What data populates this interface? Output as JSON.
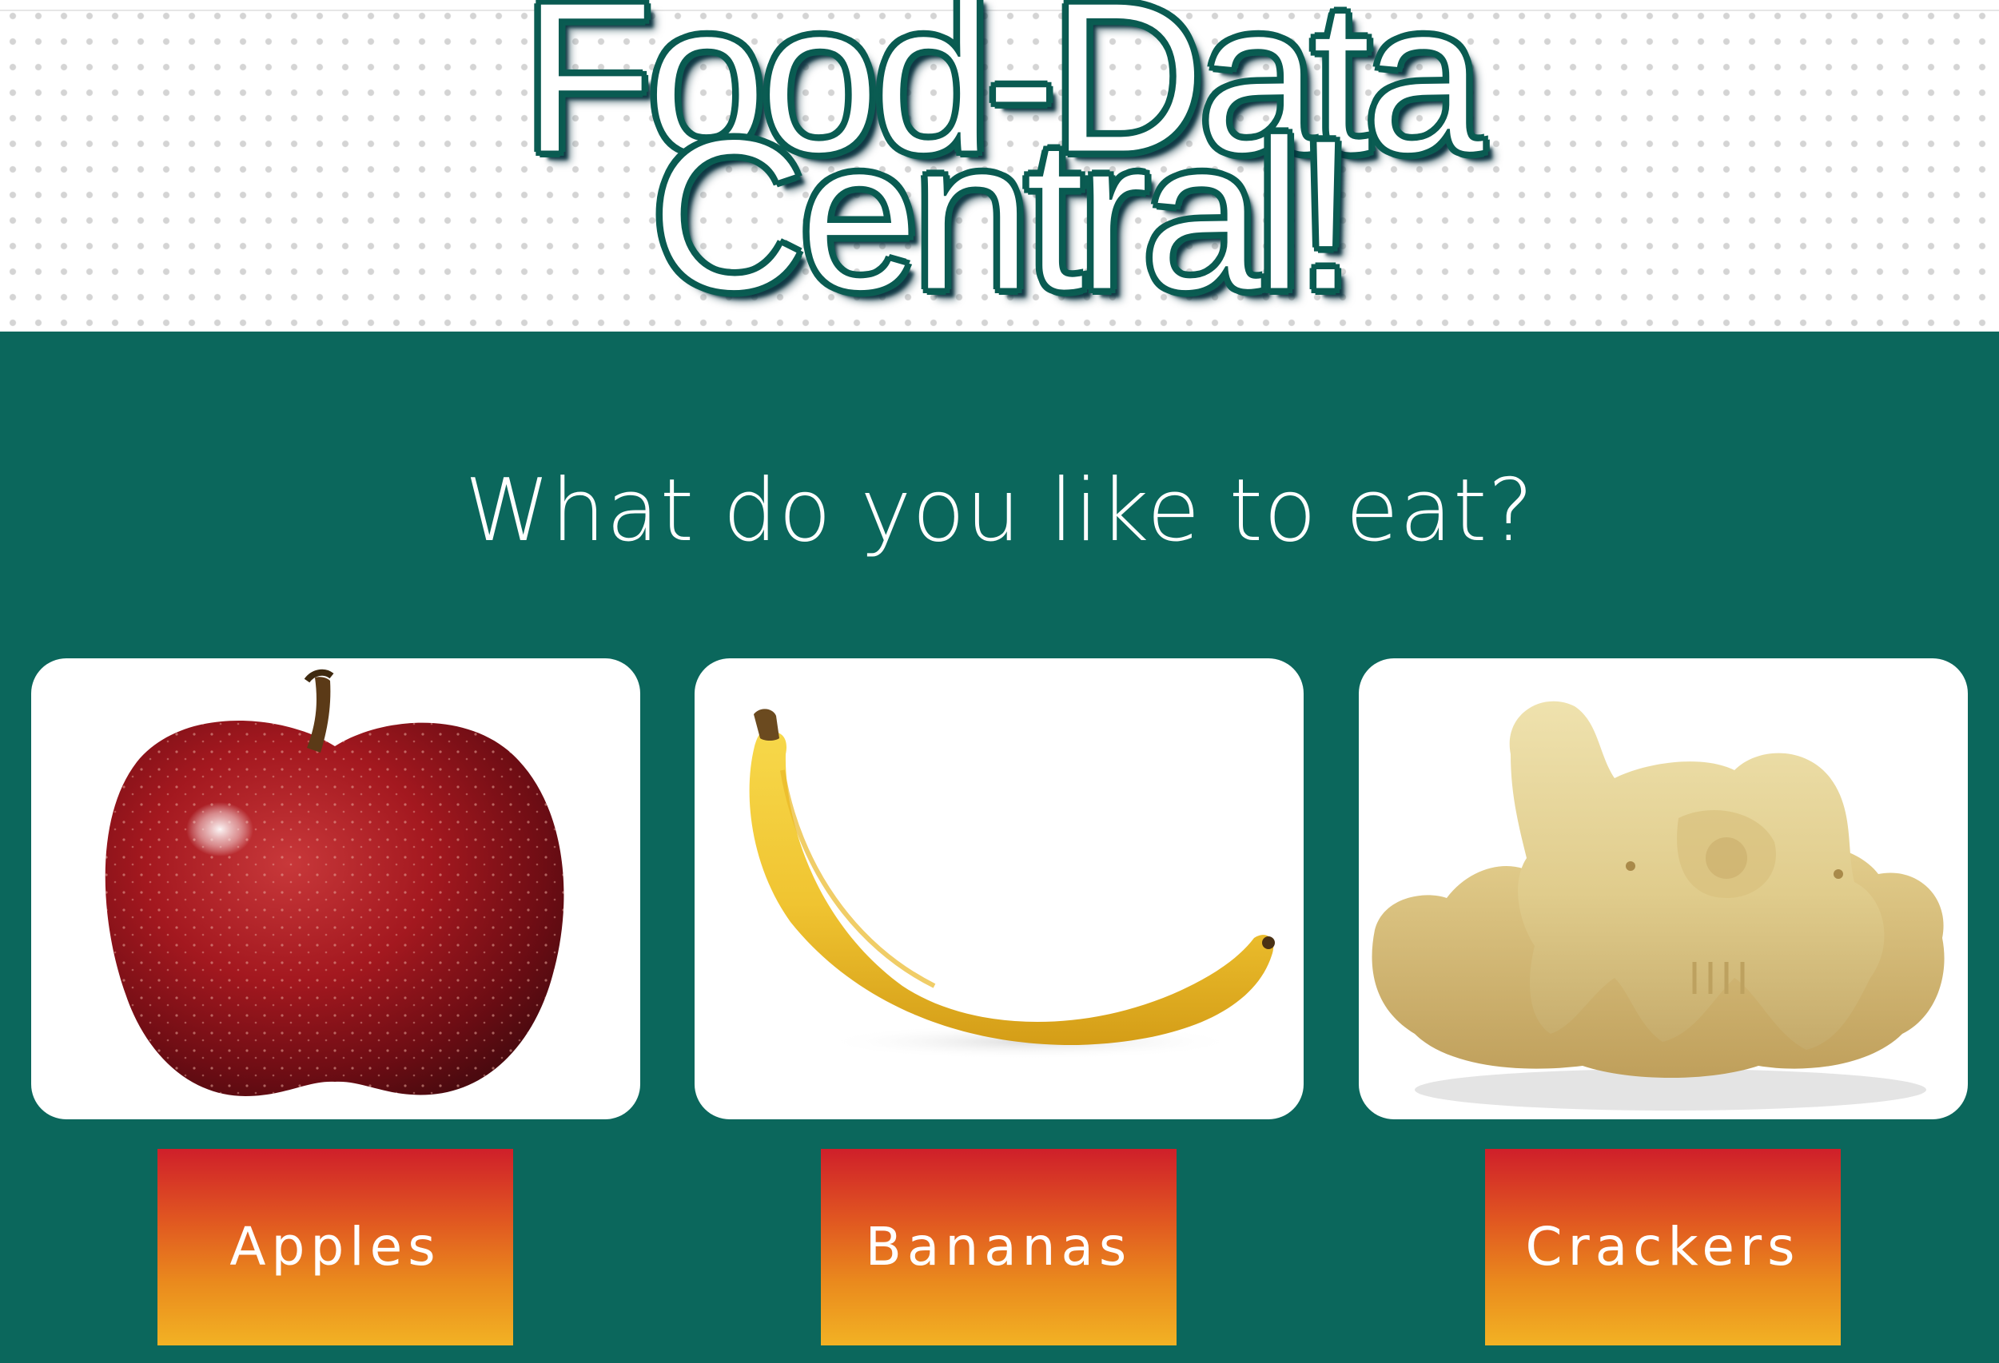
{
  "header": {
    "title_line1": "Food-Data",
    "title_line2": "Central!",
    "subtitle": "What do you like to eat?"
  },
  "foods": [
    {
      "image": "apple-image",
      "button_label": "Apples"
    },
    {
      "image": "banana-image",
      "button_label": "Bananas"
    },
    {
      "image": "crackers-image",
      "button_label": "Crackers"
    }
  ],
  "colors": {
    "background": "#0b675c",
    "title_outline": "#0a5c52",
    "button_top": "#cf1f2a",
    "button_bottom": "#f2b224"
  }
}
